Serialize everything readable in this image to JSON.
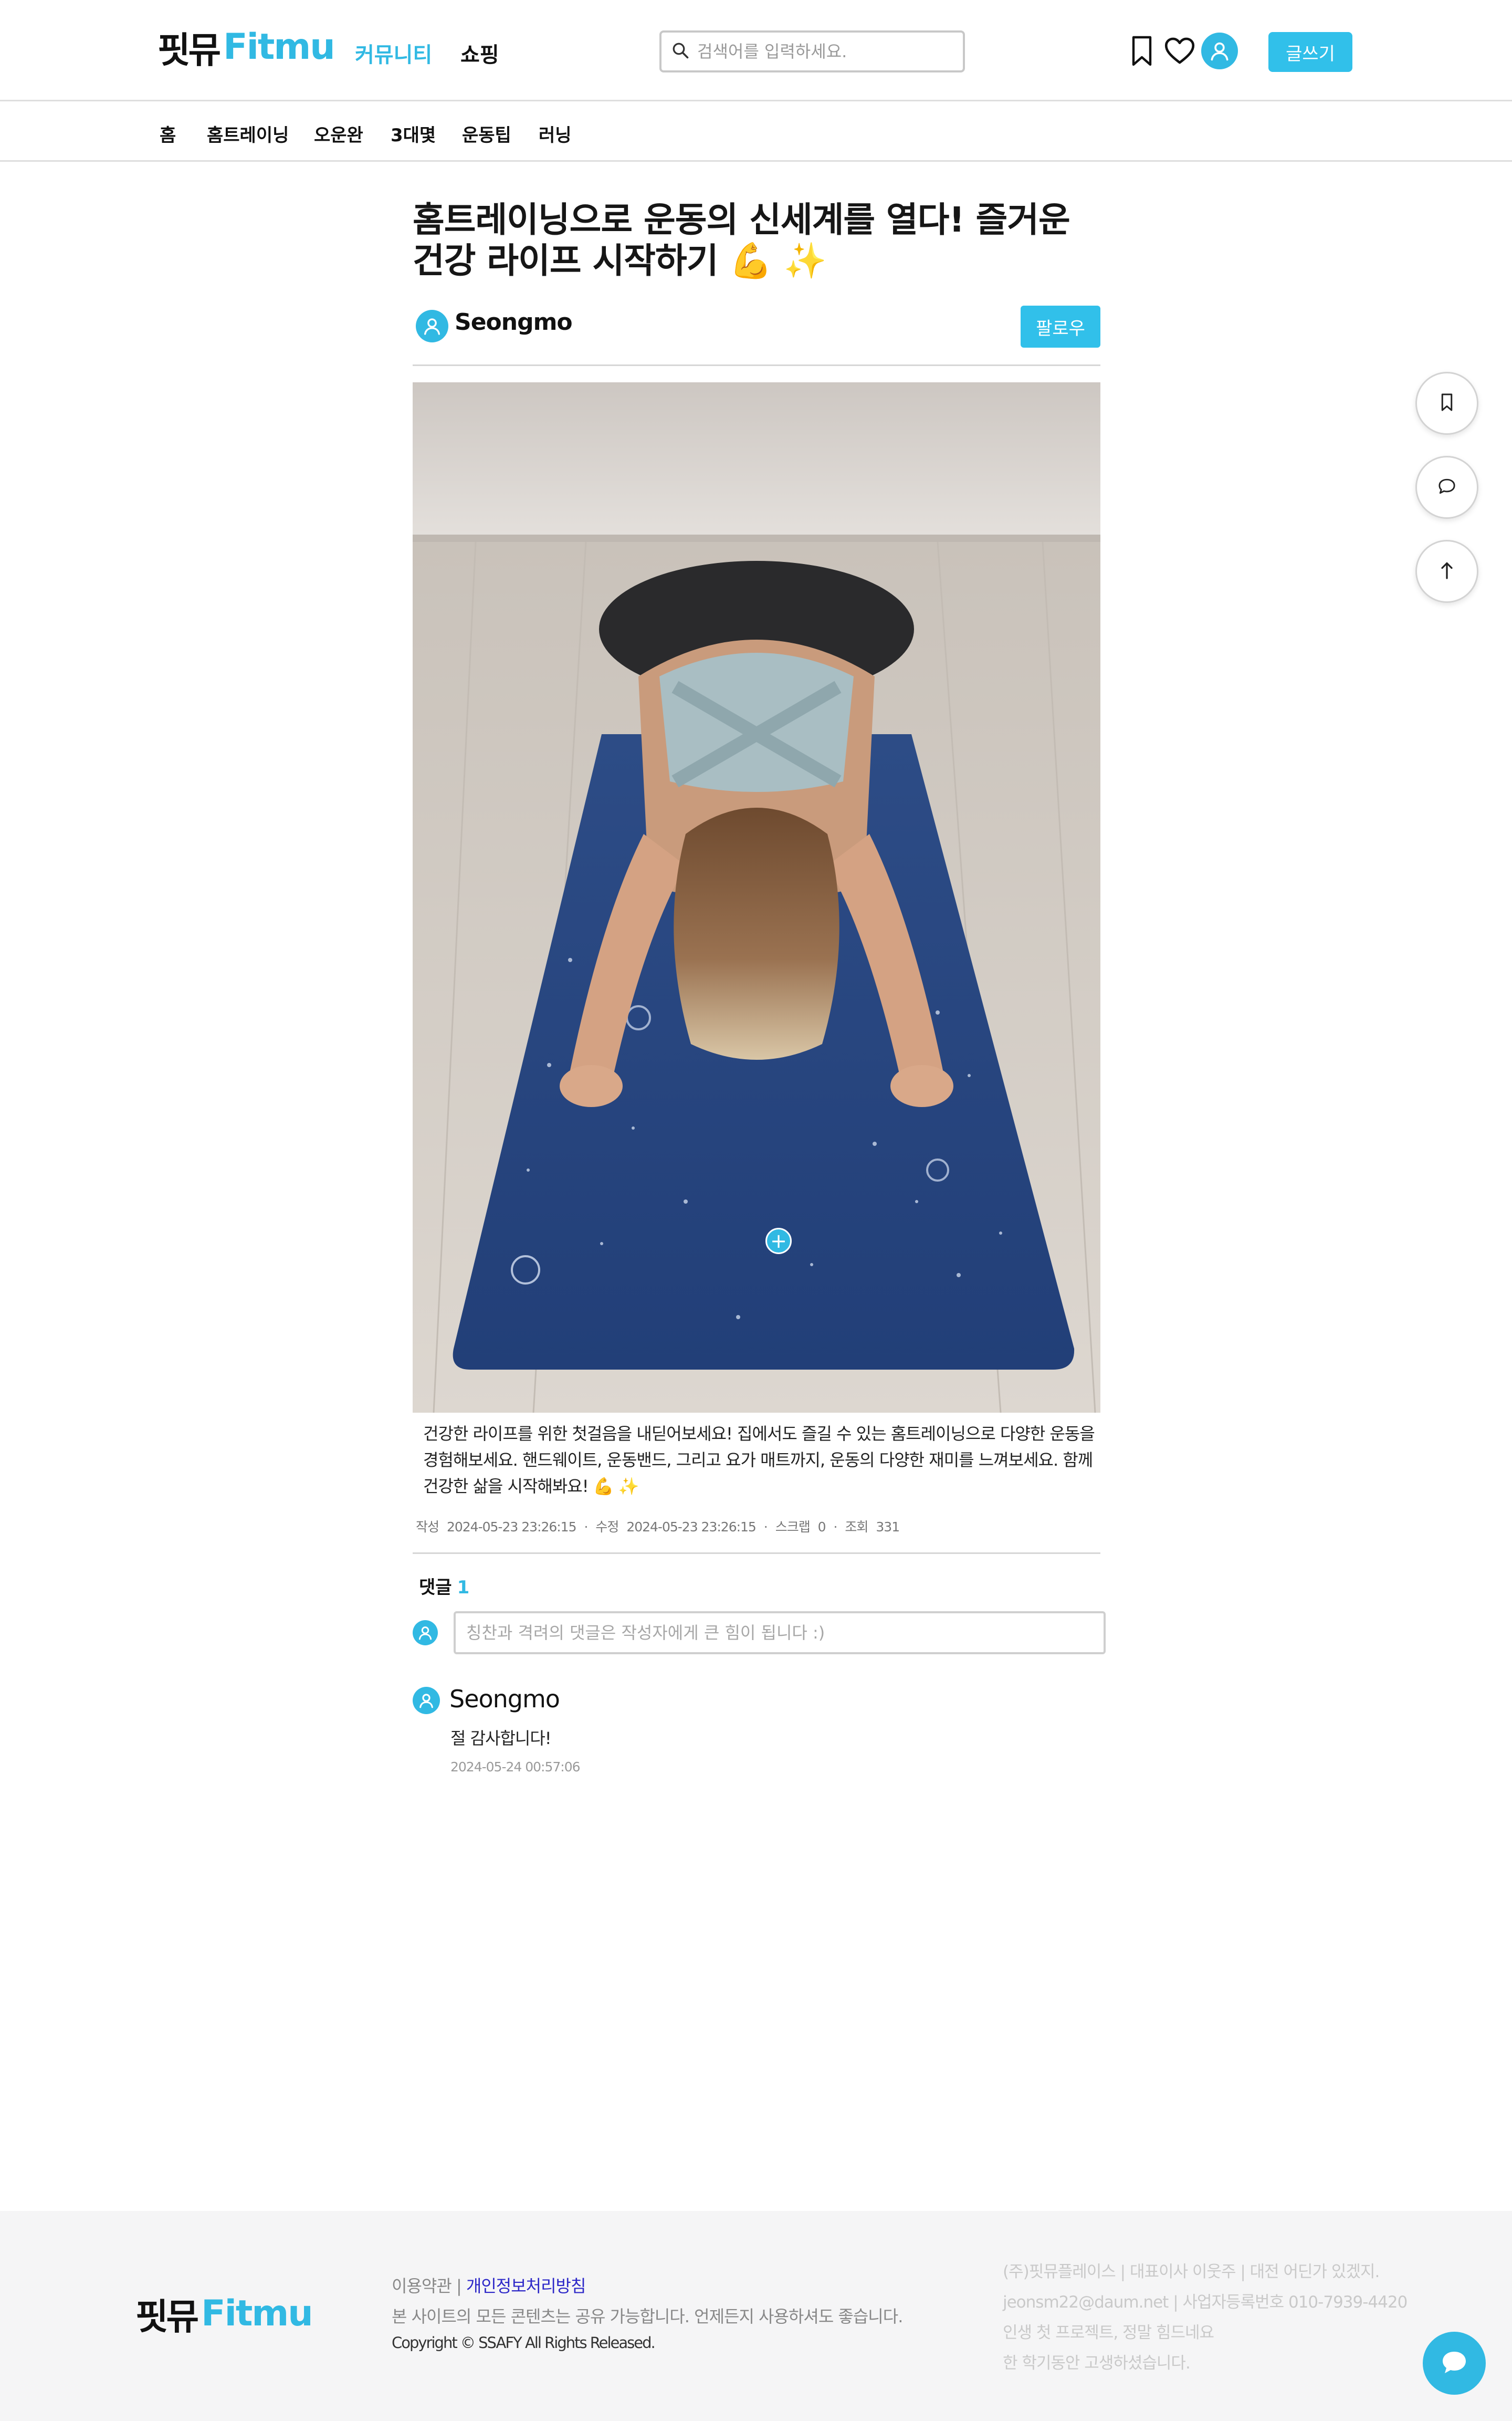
{
  "colors": {
    "accent": "#31b9e3",
    "button": "#31c0ea",
    "privacy_link": "#2d28c8"
  },
  "header": {
    "logo_ko": "핏뮤",
    "logo_en": "Fitmu",
    "nav": [
      {
        "label": "커뮤니티",
        "active": true
      },
      {
        "label": "쇼핑",
        "active": false
      }
    ],
    "search_placeholder": "검색어를 입력하세요.",
    "icons": [
      "bookmark-icon",
      "heart-icon",
      "user-avatar-icon"
    ],
    "write_label": "글쓰기"
  },
  "categories": [
    "홈",
    "홈트레이닝",
    "오운완",
    "3대몇",
    "운동팁",
    "러닝"
  ],
  "post": {
    "title": "홈트레이닝으로 운동의 신세계를 열다! 즐거운 건강 라이프 시작하기 💪 ✨",
    "author": "Seongmo",
    "follow_label": "팔로우",
    "body": "건강한 라이프를 위한 첫걸음을 내딛어보세요! 집에서도 즐길 수 있는 홈트레이닝으로 다양한 운동을 경험해보세요. 핸드웨이트, 운동밴드, 그리고 요가 매트까지, 운동의 다양한 재미를 느껴보세요. 함께 건강한 삶을 시작해봐요! 💪 ✨",
    "meta": {
      "created_label": "작성",
      "created": "2024-05-23 23:26:15",
      "modified_label": "수정",
      "modified": "2024-05-23 23:26:15",
      "scrap_label": "스크랩",
      "scrap": "0",
      "views_label": "조회",
      "views": "331"
    }
  },
  "comments": {
    "title": "댓글",
    "count": "1",
    "input_placeholder": "칭찬과 격려의 댓글은 작성자에게 큰 힘이 됩니다 :)",
    "items": [
      {
        "author": "Seongmo",
        "text": "절 감사합니다!",
        "date": "2024-05-24 00:57:06"
      }
    ]
  },
  "side_buttons": [
    "bookmark-icon",
    "comment-icon",
    "arrow-up-icon"
  ],
  "footer": {
    "terms": "이용약관",
    "separator": " | ",
    "privacy": "개인정보처리방침",
    "share_notice": "본 사이트의 모든 콘텐츠는 공유 가능합니다. 언제든지 사용하셔도 좋습니다.",
    "copyright": "Copyright © SSAFY All Rights Released.",
    "company": [
      "(주)핏뮤플레이스 | 대표이사 이웃주 | 대전 어딘가 있겠지.",
      "jeonsm22@daum.net | 사업자등록번호 010-7939-4420",
      "인생 첫 프로젝트, 정말 힘드네요",
      "한 학기동안 고생하셨습니다."
    ]
  }
}
